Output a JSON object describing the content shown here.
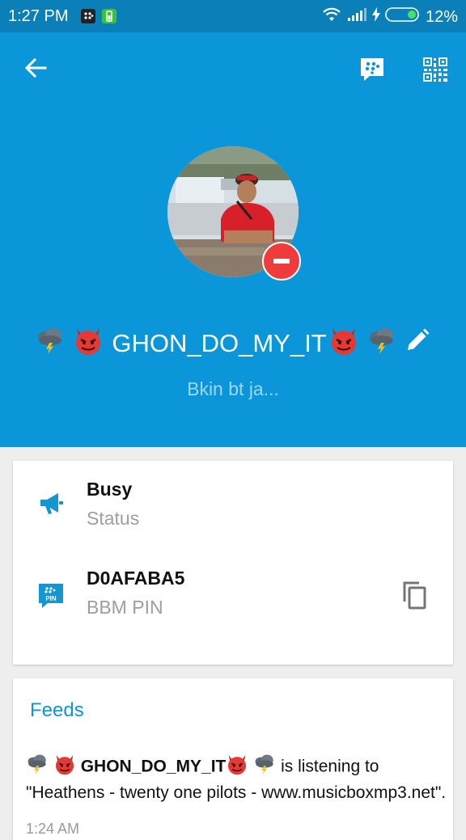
{
  "status_bar": {
    "time": "1:27 PM",
    "battery_percent": "12%"
  },
  "toolbar": {
    "back_icon": "arrow-left-icon",
    "chat_icon": "bbm-chat-icon",
    "qr_icon": "qr-code-icon"
  },
  "profile": {
    "display_name": "GHON_DO_MY_IT",
    "status_message": "Bkin bt ja...",
    "presence": "busy"
  },
  "info": {
    "status_value": "Busy",
    "status_label": "Status",
    "pin_value": "D0AFABA5",
    "pin_label": "BBM PIN",
    "pin_badge": "PIN"
  },
  "feeds": {
    "title": "Feeds",
    "name": "GHON_DO_MY_IT",
    "text": " is listening to \"Heathens - twenty one pilots - www.musicboxmp3.net\".",
    "time": "1:24 AM"
  },
  "colors": {
    "header": "#0a96d8",
    "statusbar": "#0a7fb8",
    "busy": "#ee3b3b",
    "accent": "#0a96d8"
  }
}
